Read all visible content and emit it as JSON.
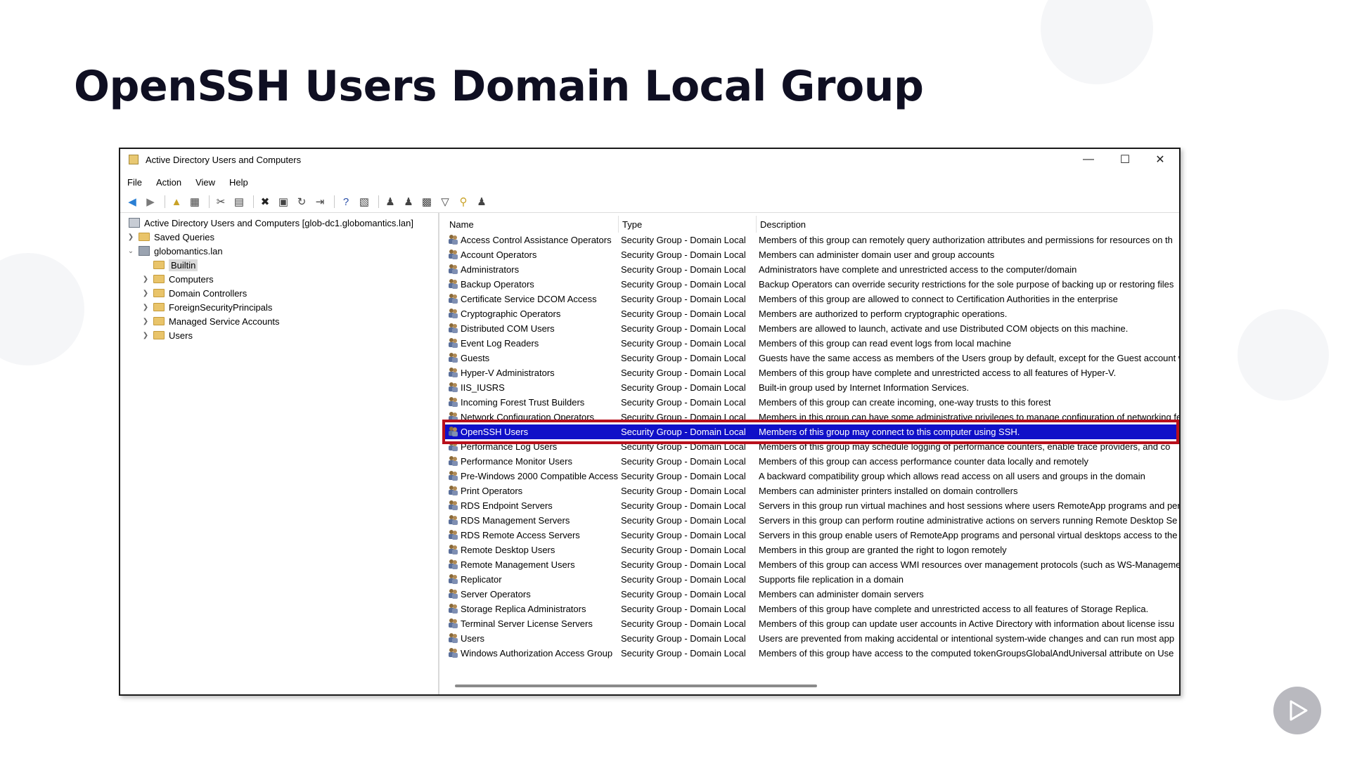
{
  "slide": {
    "title": "OpenSSH Users Domain Local Group"
  },
  "window": {
    "title": "Active Directory Users and Computers",
    "controls": {
      "minimize": "—",
      "maximize": "☐",
      "close": "✕"
    }
  },
  "menu": [
    "File",
    "Action",
    "View",
    "Help"
  ],
  "toolbar_icons": [
    "back-icon",
    "forward-icon",
    "up-folder-icon",
    "show-console-tree-icon",
    "cut-icon",
    "paste-icon",
    "delete-icon",
    "properties-icon",
    "refresh-icon",
    "export-list-icon",
    "help-icon",
    "help-topics-icon",
    "new-user-icon",
    "new-group-icon",
    "new-ou-icon",
    "filter-icon",
    "find-icon",
    "add-to-group-icon"
  ],
  "tree": {
    "root": "Active Directory Users and Computers [glob-dc1.globomantics.lan]",
    "saved_queries": "Saved Queries",
    "domain": "globomantics.lan",
    "children": [
      "Builtin",
      "Computers",
      "Domain Controllers",
      "ForeignSecurityPrincipals",
      "Managed Service Accounts",
      "Users"
    ],
    "selected": "Builtin"
  },
  "list": {
    "headers": [
      "Name",
      "Type",
      "Description"
    ],
    "rows": [
      [
        "Access Control Assistance Operators",
        "Security Group - Domain Local",
        "Members of this group can remotely query authorization attributes and permissions for resources on th"
      ],
      [
        "Account Operators",
        "Security Group - Domain Local",
        "Members can administer domain user and group accounts"
      ],
      [
        "Administrators",
        "Security Group - Domain Local",
        "Administrators have complete and unrestricted access to the computer/domain"
      ],
      [
        "Backup Operators",
        "Security Group - Domain Local",
        "Backup Operators can override security restrictions for the sole purpose of backing up or restoring files"
      ],
      [
        "Certificate Service DCOM Access",
        "Security Group - Domain Local",
        "Members of this group are allowed to connect to Certification Authorities in the enterprise"
      ],
      [
        "Cryptographic Operators",
        "Security Group - Domain Local",
        "Members are authorized to perform cryptographic operations."
      ],
      [
        "Distributed COM Users",
        "Security Group - Domain Local",
        "Members are allowed to launch, activate and use Distributed COM objects on this machine."
      ],
      [
        "Event Log Readers",
        "Security Group - Domain Local",
        "Members of this group can read event logs from local machine"
      ],
      [
        "Guests",
        "Security Group - Domain Local",
        "Guests have the same access as members of the Users group by default, except for the Guest account w"
      ],
      [
        "Hyper-V Administrators",
        "Security Group - Domain Local",
        "Members of this group have complete and unrestricted access to all features of Hyper-V."
      ],
      [
        "IIS_IUSRS",
        "Security Group - Domain Local",
        "Built-in group used by Internet Information Services."
      ],
      [
        "Incoming Forest Trust Builders",
        "Security Group - Domain Local",
        "Members of this group can create incoming, one-way trusts to this forest"
      ],
      [
        "Network Configuration Operators",
        "Security Group - Domain Local",
        "Members in this group can have some administrative privileges to manage configuration of networking fe"
      ],
      [
        "OpenSSH Users",
        "Security Group - Domain Local",
        "Members of this group may connect to this computer using SSH."
      ],
      [
        "Performance Log Users",
        "Security Group - Domain Local",
        "Members of this group may schedule logging of performance counters, enable trace providers, and co"
      ],
      [
        "Performance Monitor Users",
        "Security Group - Domain Local",
        "Members of this group can access performance counter data locally and remotely"
      ],
      [
        "Pre-Windows 2000 Compatible Access",
        "Security Group - Domain Local",
        "A backward compatibility group which allows read access on all users and groups in the domain"
      ],
      [
        "Print Operators",
        "Security Group - Domain Local",
        "Members can administer printers installed on domain controllers"
      ],
      [
        "RDS Endpoint Servers",
        "Security Group - Domain Local",
        "Servers in this group run virtual machines and host sessions where users RemoteApp programs and per"
      ],
      [
        "RDS Management Servers",
        "Security Group - Domain Local",
        "Servers in this group can perform routine administrative actions on servers running Remote Desktop Se"
      ],
      [
        "RDS Remote Access Servers",
        "Security Group - Domain Local",
        "Servers in this group enable users of RemoteApp programs and personal virtual desktops access to the"
      ],
      [
        "Remote Desktop Users",
        "Security Group - Domain Local",
        "Members in this group are granted the right to logon remotely"
      ],
      [
        "Remote Management Users",
        "Security Group - Domain Local",
        "Members of this group can access WMI resources over management protocols (such as WS-Manageme"
      ],
      [
        "Replicator",
        "Security Group - Domain Local",
        "Supports file replication in a domain"
      ],
      [
        "Server Operators",
        "Security Group - Domain Local",
        "Members can administer domain servers"
      ],
      [
        "Storage Replica Administrators",
        "Security Group - Domain Local",
        "Members of this group have complete and unrestricted access to all features of Storage Replica."
      ],
      [
        "Terminal Server License Servers",
        "Security Group - Domain Local",
        "Members of this group can update user accounts in Active Directory with information about license issu"
      ],
      [
        "Users",
        "Security Group - Domain Local",
        "Users are prevented from making accidental or intentional system-wide changes and can run most app"
      ],
      [
        "Windows Authorization Access Group",
        "Security Group - Domain Local",
        "Members of this group have access to the computed tokenGroupsGlobalAndUniversal attribute on Use"
      ]
    ],
    "selected_index": 13
  },
  "colors": {
    "selection": "#1010c8",
    "highlight_border": "#b8101c",
    "title_text": "#0f0f22"
  },
  "play_icon": "play-icon"
}
